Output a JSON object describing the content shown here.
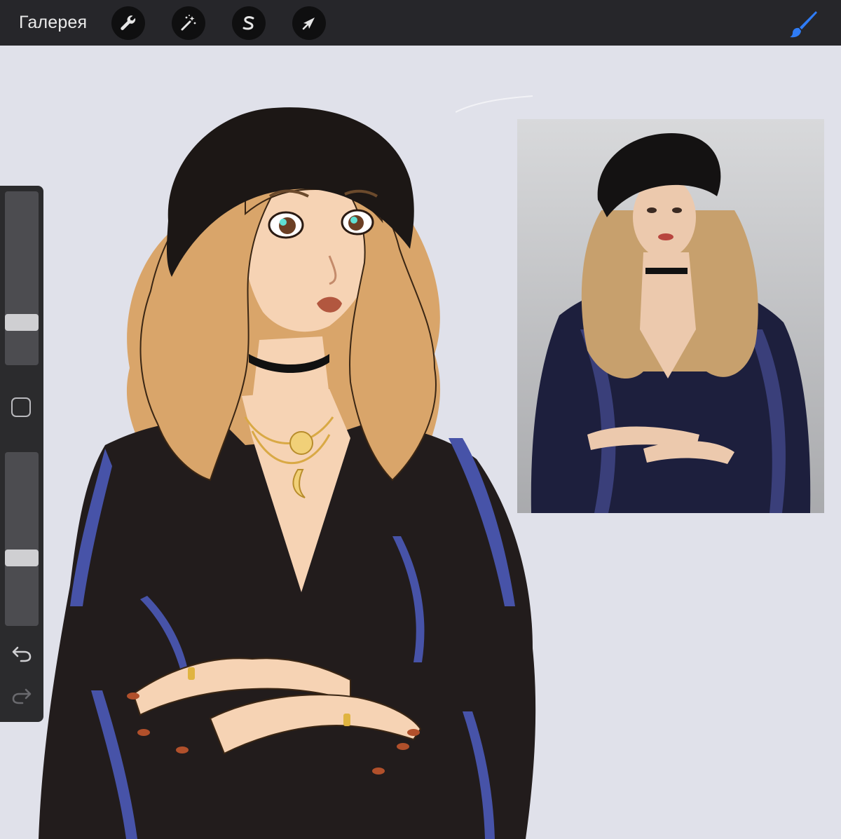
{
  "toolbar": {
    "gallery_label": "Галерея",
    "tools": [
      {
        "icon": "wrench-icon",
        "name": "actions"
      },
      {
        "icon": "magic-wand-icon",
        "name": "adjustments"
      },
      {
        "icon": "selection-s-icon",
        "name": "selection"
      },
      {
        "icon": "arrow-cursor-icon",
        "name": "transform"
      }
    ],
    "brush_icon": "paintbrush-icon",
    "brush_color": "#2f7cf6"
  },
  "sidebar": {
    "brush_size_level": 0.22,
    "opacity_level": 0.38,
    "icons": [
      "square-modify-icon",
      "undo-icon",
      "redo-icon"
    ]
  },
  "colors": {
    "canvas_bg": "#e0e1ea",
    "topbar_bg": "#26262a",
    "robe": "#221c1c",
    "robe_highlight": "#4753a8",
    "hair": "#d9a56a",
    "skin": "#f6d3b4",
    "hat": "#1c1715"
  }
}
